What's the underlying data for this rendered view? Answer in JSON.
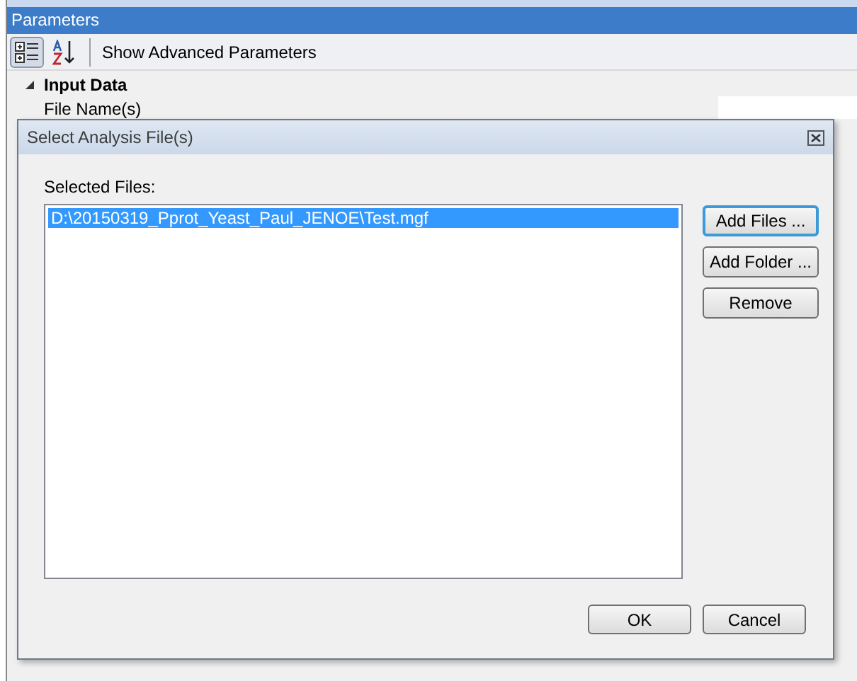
{
  "panel": {
    "title": "Parameters"
  },
  "toolbar": {
    "sort_buttons": [
      {
        "kind": "categorized",
        "selected": true
      },
      {
        "kind": "alphabetical",
        "selected": false
      }
    ],
    "advanced_button": "Show Advanced Parameters"
  },
  "property_grid": {
    "category": {
      "label": "Input Data",
      "expanded": true
    },
    "properties": [
      {
        "label": "File Name(s)"
      }
    ]
  },
  "dialog": {
    "title": "Select Analysis File(s)",
    "list_label": "Selected Files:",
    "files": [
      {
        "path": "D:\\20150319_Pprot_Yeast_Paul_JENOE\\Test.mgf",
        "selected": true
      }
    ],
    "side_buttons": [
      {
        "label": "Add Files ...",
        "default": true
      },
      {
        "label": "Add Folder ...",
        "default": false
      },
      {
        "label": "Remove",
        "default": false
      }
    ],
    "buttons": [
      "OK",
      "Cancel"
    ]
  }
}
